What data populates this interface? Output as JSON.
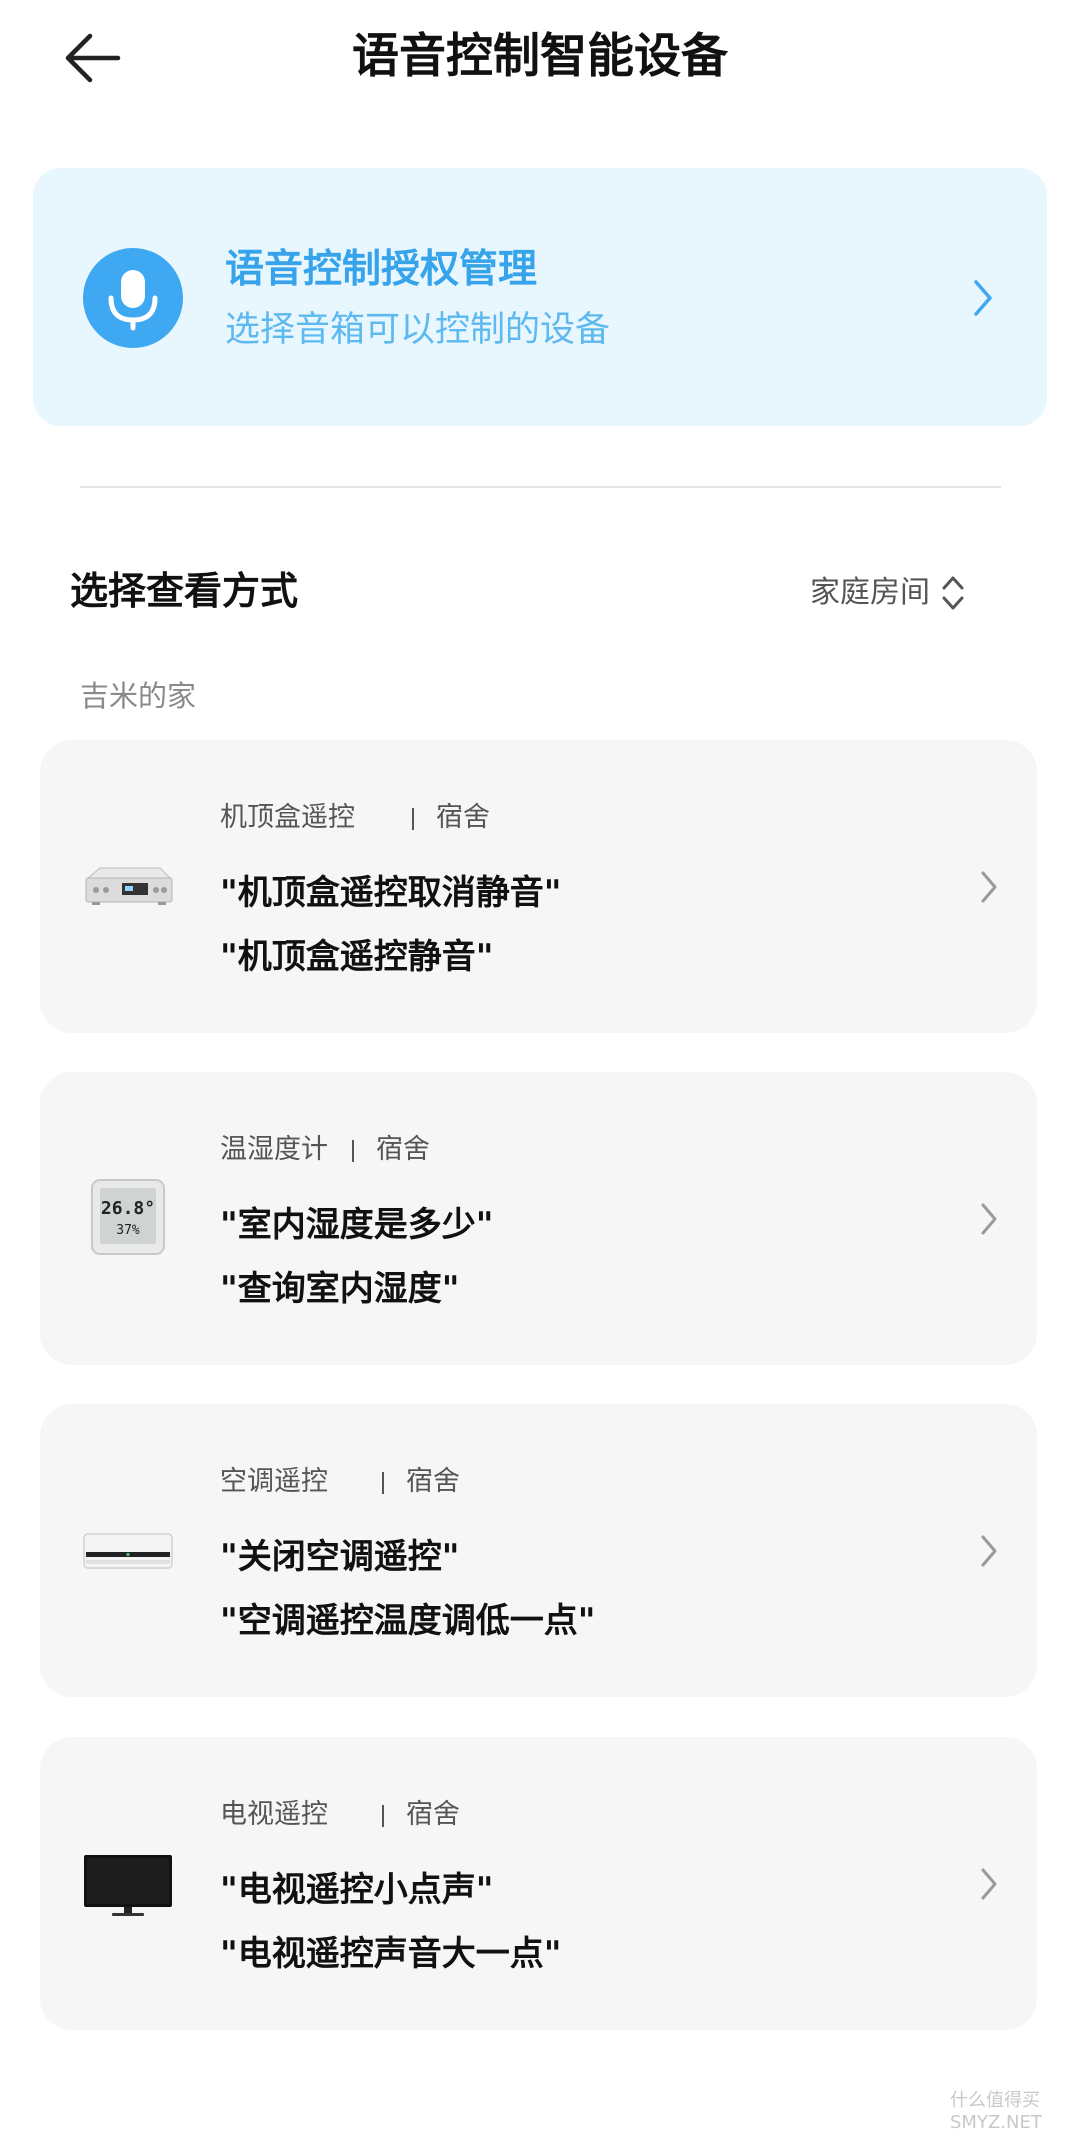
{
  "header": {
    "title": "语音控制智能设备",
    "back_icon": "back-arrow-icon"
  },
  "auth_card": {
    "title": "语音控制授权管理",
    "subtitle": "选择音箱可以控制的设备",
    "icon": "microphone-icon",
    "accent_color": "#3ea8f2",
    "background_color": "#e8f6fe"
  },
  "view_mode": {
    "label": "选择查看方式",
    "selected": "家庭房间",
    "icon": "up-down-chevron-icon"
  },
  "home": {
    "name": "吉米的家"
  },
  "devices": [
    {
      "name": "机顶盒遥控",
      "room": "宿舍",
      "icon": "set-top-box-icon",
      "commands": [
        "\"机顶盒遥控取消静音\"",
        "\"机顶盒遥控静音\""
      ]
    },
    {
      "name": "温湿度计",
      "room": "宿舍",
      "icon": "thermo-hygrometer-icon",
      "display_top": "26.8°",
      "display_bottom": "37%",
      "commands": [
        "\"室内湿度是多少\"",
        "\"查询室内湿度\""
      ]
    },
    {
      "name": "空调遥控",
      "room": "宿舍",
      "icon": "air-conditioner-icon",
      "commands": [
        "\"关闭空调遥控\"",
        "\"空调遥控温度调低一点\""
      ]
    },
    {
      "name": "电视遥控",
      "room": "宿舍",
      "icon": "television-icon",
      "commands": [
        "\"电视遥控小点声\"",
        "\"电视遥控声音大一点\""
      ]
    }
  ],
  "watermark": "什么值得买\nSMYZ.NET"
}
